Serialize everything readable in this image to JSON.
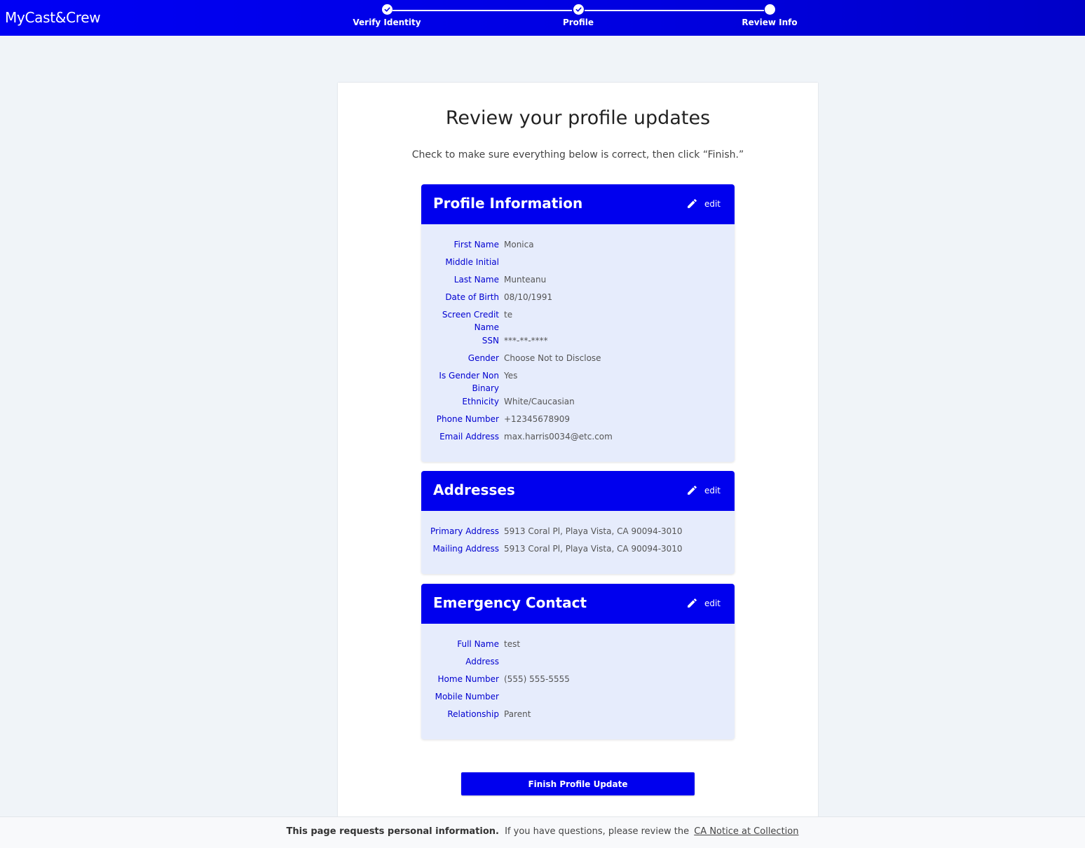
{
  "app": {
    "brand": "MyCast&Crew"
  },
  "stepper": {
    "steps": [
      {
        "label": "Verify Identity",
        "state": "done"
      },
      {
        "label": "Profile",
        "state": "done"
      },
      {
        "label": "Review Info",
        "state": "current"
      }
    ]
  },
  "page": {
    "title": "Review your profile updates",
    "subtitle": "Check to make sure everything below is correct, then click “Finish.”"
  },
  "sections": {
    "profile": {
      "title": "Profile Information",
      "edit_label": "edit",
      "rows": [
        {
          "label": "First Name",
          "value": "Monica"
        },
        {
          "label": "Middle Initial",
          "value": ""
        },
        {
          "label": "Last Name",
          "value": "Munteanu"
        },
        {
          "label": "Date of Birth",
          "value": "08/10/1991"
        },
        {
          "label": "Screen Credit Name",
          "value": "te"
        },
        {
          "label": "SSN",
          "value": "***-**-****"
        },
        {
          "label": "Gender",
          "value": "Choose Not to Disclose"
        },
        {
          "label": "Is Gender Non Binary",
          "value": "Yes"
        },
        {
          "label": "Ethnicity",
          "value": "White/Caucasian"
        },
        {
          "label": "Phone Number",
          "value": "+12345678909"
        },
        {
          "label": "Email Address",
          "value": "max.harris0034@etc.com"
        }
      ]
    },
    "addresses": {
      "title": "Addresses",
      "edit_label": "edit",
      "rows": [
        {
          "label": "Primary Address",
          "value": "5913 Coral Pl, Playa Vista, CA 90094-3010"
        },
        {
          "label": "Mailing Address",
          "value": "5913 Coral Pl, Playa Vista, CA 90094-3010"
        }
      ]
    },
    "emergency": {
      "title": "Emergency Contact",
      "edit_label": "edit",
      "rows": [
        {
          "label": "Full Name",
          "value": "test"
        },
        {
          "label": "Address",
          "value": ""
        },
        {
          "label": "Home Number",
          "value": "(555) 555-5555"
        },
        {
          "label": "Mobile Number",
          "value": ""
        },
        {
          "label": "Relationship",
          "value": "Parent"
        }
      ]
    }
  },
  "actions": {
    "finish_label": "Finish Profile Update"
  },
  "footer": {
    "bold_text": "This page requests personal information.",
    "text": "If you have questions, please review the",
    "link_text": "CA Notice at Collection"
  },
  "colors": {
    "primary": "#0000ee",
    "section_bg": "#e6ecfc",
    "label": "#0000d0",
    "page_bg": "#f0f4f8"
  }
}
